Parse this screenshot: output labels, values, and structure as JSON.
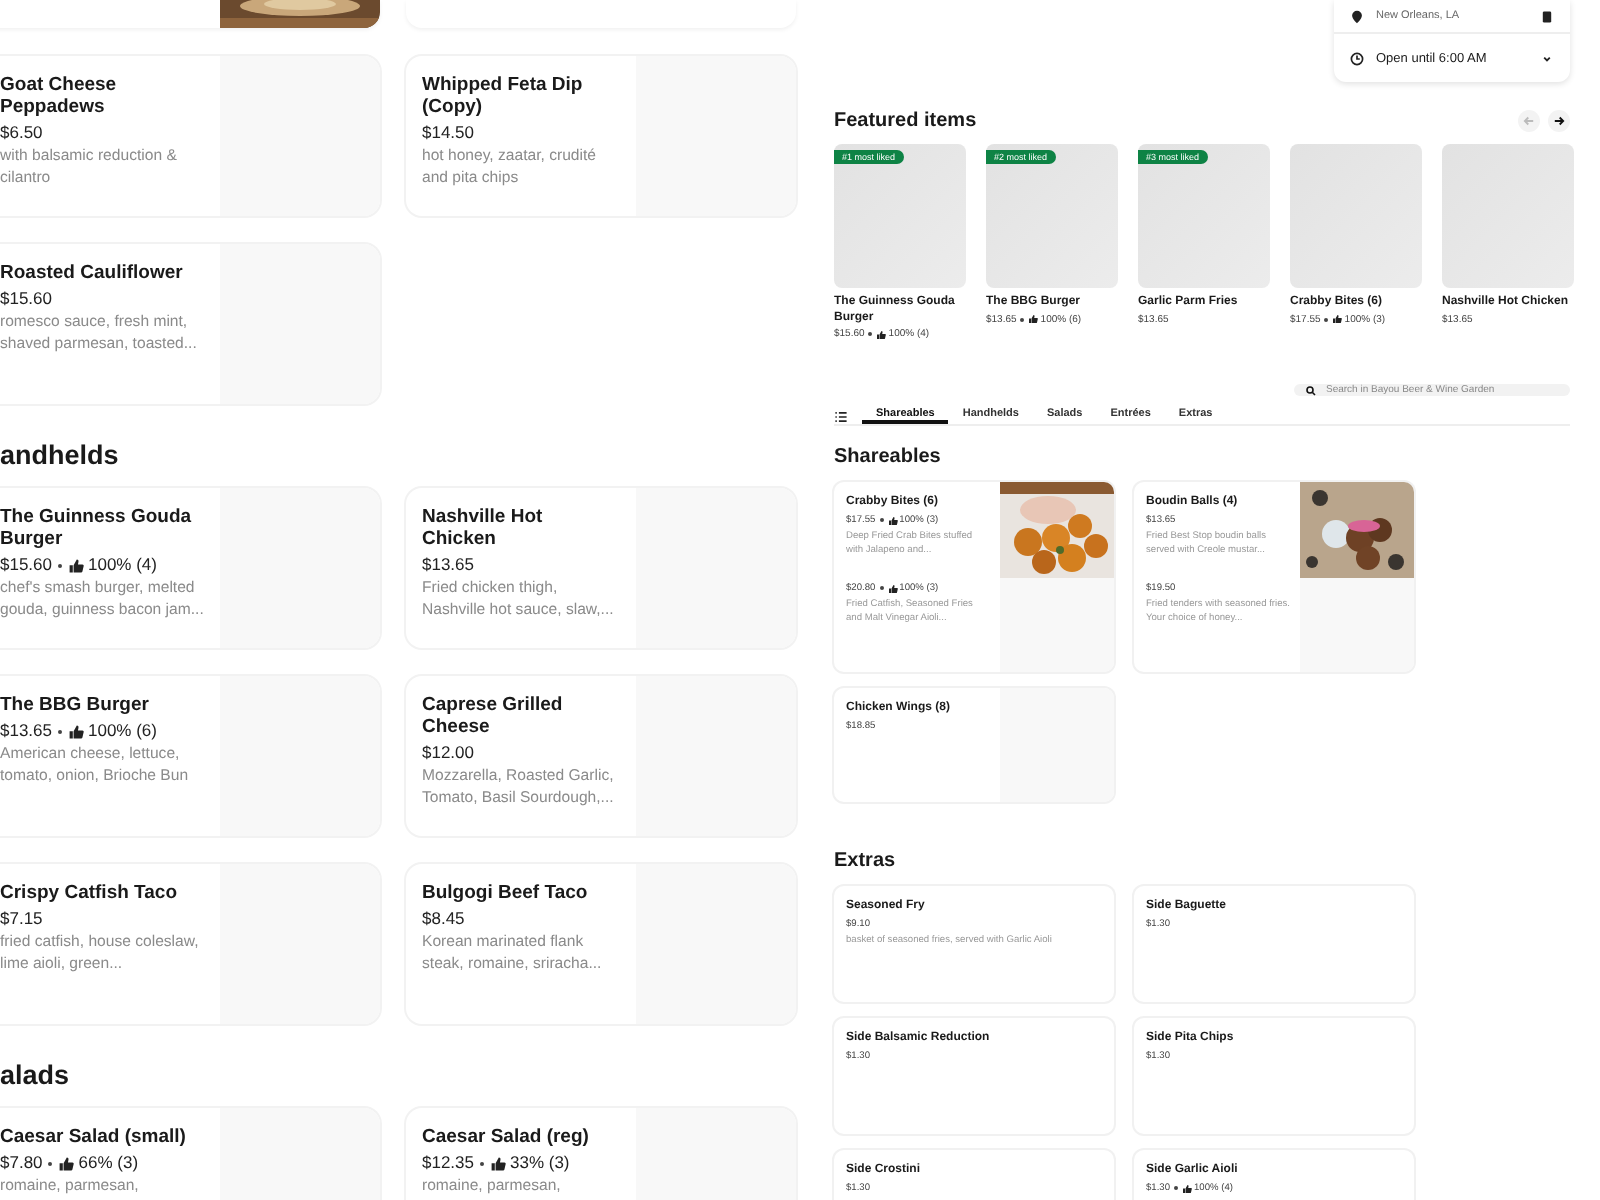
{
  "left_panel": {
    "sections": [
      {
        "items": [
          {
            "name": "Goat Cheese Peppadews",
            "price": "$6.50",
            "description": "with balsamic reduction & cilantro"
          },
          {
            "name": "Whipped Feta Dip (Copy)",
            "price": "$14.50",
            "description": "hot honey, zaatar, crudité and pita chips"
          },
          {
            "name": "Roasted Cauliflower",
            "price": "$15.60",
            "description": "romesco sauce, fresh mint, shaved parmesan, toasted..."
          }
        ]
      },
      {
        "heading": "andhelds",
        "items": [
          {
            "name": "The Guinness Gouda Burger",
            "price": "$15.60",
            "rating": "100% (4)",
            "description": "chef's smash burger, melted gouda, guinness bacon jam..."
          },
          {
            "name": "Nashville Hot Chicken",
            "price": "$13.65",
            "description": "Fried chicken thigh, Nashville hot sauce, slaw,..."
          },
          {
            "name": "The BBG Burger",
            "price": "$13.65",
            "rating": "100% (6)",
            "description": "American cheese, lettuce, tomato, onion, Brioche Bun"
          },
          {
            "name": "Caprese Grilled Cheese",
            "price": "$12.00",
            "description": "Mozzarella, Roasted Garlic, Tomato, Basil Sourdough,..."
          },
          {
            "name": "Crispy Catfish Taco",
            "price": "$7.15",
            "description": "fried catfish, house coleslaw, lime aioli, green..."
          },
          {
            "name": "Bulgogi Beef Taco",
            "price": "$8.45",
            "description": "Korean marinated flank steak, romaine, sriracha..."
          }
        ]
      },
      {
        "heading": "alads",
        "items": [
          {
            "name": "Caesar Salad (small)",
            "price": "$7.80",
            "rating": "66% (3)",
            "description": "romaine, parmesan,"
          },
          {
            "name": "Caesar Salad (reg)",
            "price": "$12.35",
            "rating": "33% (3)",
            "description": "romaine, parmesan,"
          }
        ]
      }
    ]
  },
  "location": {
    "city": "New Orleans, LA",
    "hours": "Open until 6:00 AM"
  },
  "featured": {
    "title": "Featured items",
    "items": [
      {
        "badge": "#1 most liked",
        "name": "The Guinness Gouda Burger",
        "price": "$15.60",
        "rating": "100% (4)"
      },
      {
        "badge": "#2 most liked",
        "name": "The BBG Burger",
        "price": "$13.65",
        "rating": "100% (6)"
      },
      {
        "badge": "#3 most liked",
        "name": "Garlic Parm Fries",
        "price": "$13.65"
      },
      {
        "name": "Crabby Bites (6)",
        "price": "$17.55",
        "rating": "100% (3)"
      },
      {
        "name": "Nashville Hot Chicken",
        "price": "$13.65"
      }
    ]
  },
  "search": {
    "placeholder": "Search in Bayou Beer & Wine Garden"
  },
  "tabs": [
    {
      "label": "Shareables",
      "selected": true
    },
    {
      "label": "Handhelds",
      "selected": false
    },
    {
      "label": "Salads",
      "selected": false
    },
    {
      "label": "Entrées",
      "selected": false
    },
    {
      "label": "Extras",
      "selected": false
    }
  ],
  "sections": [
    {
      "heading": "Shareables",
      "items": [
        {
          "name": "Crabby Bites (6)",
          "price": "$17.55",
          "rating": "100% (3)",
          "description": "Deep Fried Crab Bites stuffed with Jalapeno and...",
          "has_photo": true,
          "more": {
            "price": "$20.80",
            "rating": "100% (3)",
            "description": "Fried Catfish, Seasoned Fries and Malt Vinegar Aioli..."
          }
        },
        {
          "name": "Boudin Balls (4)",
          "price": "$13.65",
          "description": "Fried Best Stop boudin balls served with Creole mustar...",
          "has_photo": true,
          "more": {
            "price": "$19.50",
            "description": "Fried tenders with seasoned fries. Your choice of honey..."
          }
        },
        {
          "name": "Chicken Wings (8)",
          "price": "$18.85",
          "has_photo": false
        }
      ]
    },
    {
      "heading": "Extras",
      "kind": "plain",
      "items": [
        {
          "name": "Seasoned Fry",
          "price": "$9.10",
          "description": "basket of seasoned fries, served with Garlic Aioli"
        },
        {
          "name": "Side Baguette",
          "price": "$1.30"
        },
        {
          "name": "Side Balsamic Reduction",
          "price": "$1.30"
        },
        {
          "name": "Side Pita Chips",
          "price": "$1.30"
        },
        {
          "name": "Side Crostini",
          "price": "$1.30"
        },
        {
          "name": "Side Garlic Aioli",
          "price": "$1.30",
          "rating": "100% (4)"
        }
      ]
    }
  ]
}
